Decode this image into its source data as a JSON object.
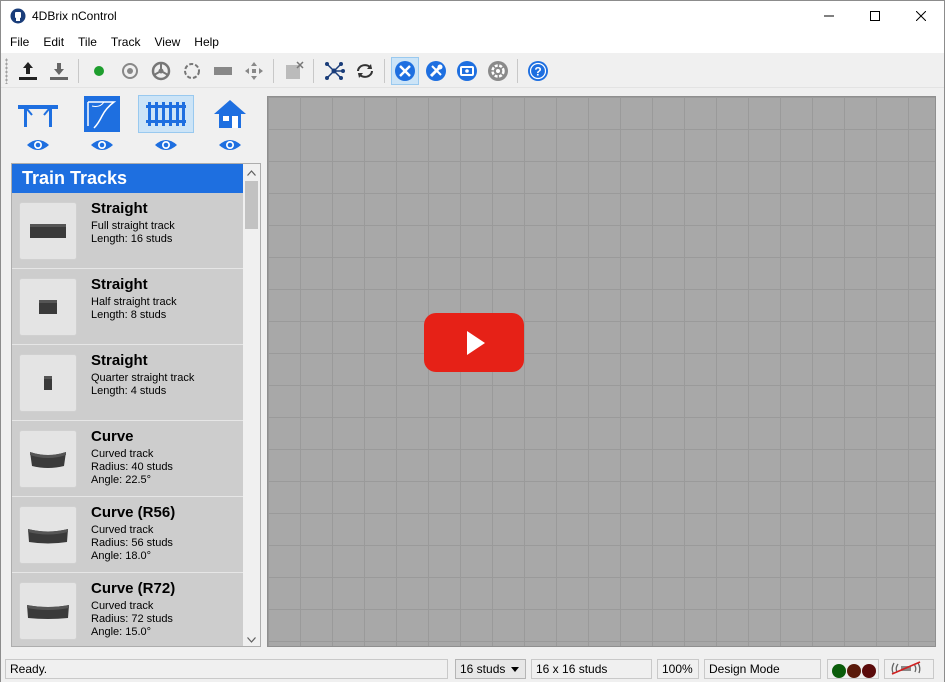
{
  "window": {
    "title": "4DBrix nControl"
  },
  "menu": {
    "items": [
      "File",
      "Edit",
      "Tile",
      "Track",
      "View",
      "Help"
    ]
  },
  "toolbar": {
    "buttons": [
      "upload-icon",
      "download-icon",
      "green-dot-icon",
      "target-icon",
      "steering-icon",
      "circle-track-icon",
      "train-car-icon",
      "move-icon",
      "close-box-icon",
      "network-icon",
      "loop-icon",
      "design-tools-icon",
      "wrench-icon",
      "monitor-icon",
      "gear-icon",
      "help-icon"
    ]
  },
  "categories": {
    "items": [
      "bridge-icon",
      "track-curve-icon",
      "fence-icon",
      "house-icon"
    ]
  },
  "list": {
    "header": "Train Tracks",
    "items": [
      {
        "name": "Straight",
        "lines": [
          "Full straight track",
          "Length: 16 studs"
        ]
      },
      {
        "name": "Straight",
        "lines": [
          "Half straight track",
          "Length: 8 studs"
        ]
      },
      {
        "name": "Straight",
        "lines": [
          "Quarter straight track",
          "Length: 4 studs"
        ]
      },
      {
        "name": "Curve",
        "lines": [
          "Curved track",
          "Radius: 40 studs",
          "Angle: 22.5°"
        ]
      },
      {
        "name": "Curve (R56)",
        "lines": [
          "Curved track",
          "Radius: 56 studs",
          "Angle: 18.0°"
        ]
      },
      {
        "name": "Curve (R72)",
        "lines": [
          "Curved track",
          "Radius: 72 studs",
          "Angle: 15.0°"
        ]
      }
    ]
  },
  "status": {
    "text": "Ready.",
    "stud_select": "16 studs",
    "grid_size": "16 x 16 studs",
    "zoom": "100%",
    "mode": "Design Mode",
    "lights": [
      "#0a5c0a",
      "#5a1a0a",
      "#5a0a0a"
    ],
    "play_color": "#e62117"
  }
}
